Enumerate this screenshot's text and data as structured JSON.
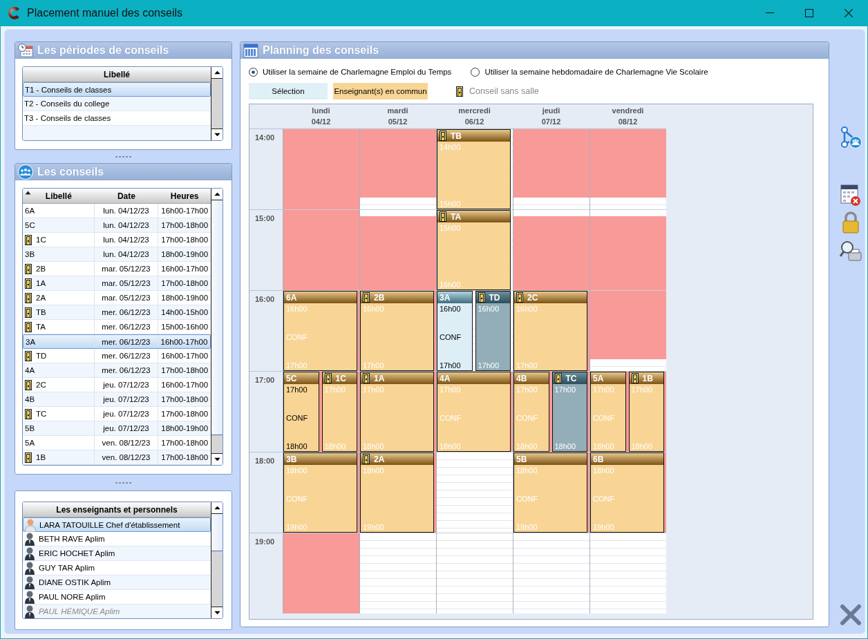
{
  "window": {
    "title": "Placement manuel des conseils"
  },
  "periods": {
    "title": "Les périodes de conseils",
    "column": "Libellé",
    "rows": [
      {
        "label": "T1 - Conseils de classes",
        "selected": true
      },
      {
        "label": "T2 - Conseils du college",
        "selected": false
      },
      {
        "label": "T3 - Conseils de classes",
        "selected": false
      }
    ]
  },
  "councils": {
    "title": "Les conseils",
    "columns": [
      "Libellé",
      "Date",
      "Heures"
    ],
    "rows": [
      {
        "label": "6A",
        "date": "lun. 04/12/23",
        "hours": "16h00-17h00",
        "no_room": false,
        "selected": false
      },
      {
        "label": "5C",
        "date": "lun. 04/12/23",
        "hours": "17h00-18h00",
        "no_room": false,
        "selected": false
      },
      {
        "label": "1C",
        "date": "lun. 04/12/23",
        "hours": "17h00-18h00",
        "no_room": true,
        "selected": false
      },
      {
        "label": "3B",
        "date": "lun. 04/12/23",
        "hours": "18h00-19h00",
        "no_room": false,
        "selected": false
      },
      {
        "label": "2B",
        "date": "mar. 05/12/23",
        "hours": "16h00-17h00",
        "no_room": true,
        "selected": false
      },
      {
        "label": "1A",
        "date": "mar. 05/12/23",
        "hours": "17h00-18h00",
        "no_room": true,
        "selected": false
      },
      {
        "label": "2A",
        "date": "mar. 05/12/23",
        "hours": "18h00-19h00",
        "no_room": true,
        "selected": false
      },
      {
        "label": "TB",
        "date": "mer. 06/12/23",
        "hours": "14h00-15h00",
        "no_room": true,
        "selected": false
      },
      {
        "label": "TA",
        "date": "mer. 06/12/23",
        "hours": "15h00-16h00",
        "no_room": true,
        "selected": false
      },
      {
        "label": "3A",
        "date": "mer. 06/12/23",
        "hours": "16h00-17h00",
        "no_room": false,
        "selected": true
      },
      {
        "label": "TD",
        "date": "mer. 06/12/23",
        "hours": "16h00-17h00",
        "no_room": true,
        "selected": false
      },
      {
        "label": "4A",
        "date": "mer. 06/12/23",
        "hours": "17h00-18h00",
        "no_room": false,
        "selected": false
      },
      {
        "label": "2C",
        "date": "jeu. 07/12/23",
        "hours": "16h00-17h00",
        "no_room": true,
        "selected": false
      },
      {
        "label": "4B",
        "date": "jeu. 07/12/23",
        "hours": "17h00-18h00",
        "no_room": false,
        "selected": false
      },
      {
        "label": "TC",
        "date": "jeu. 07/12/23",
        "hours": "17h00-18h00",
        "no_room": true,
        "selected": false
      },
      {
        "label": "5B",
        "date": "jeu. 07/12/23",
        "hours": "18h00-19h00",
        "no_room": false,
        "selected": false
      },
      {
        "label": "5A",
        "date": "ven. 08/12/23",
        "hours": "17h00-18h00",
        "no_room": false,
        "selected": false
      },
      {
        "label": "1B",
        "date": "ven. 08/12/23",
        "hours": "17h00-18h00",
        "no_room": true,
        "selected": false
      }
    ]
  },
  "staff": {
    "title": "Les enseignants et personnels",
    "rows": [
      {
        "name": "LARA TATOUILLE Chef d'établissement",
        "kind": "head",
        "selected": true,
        "disabled": false
      },
      {
        "name": "BETH RAVE Aplim",
        "kind": "teacher",
        "selected": false,
        "disabled": false
      },
      {
        "name": "ERIC HOCHET Aplim",
        "kind": "teacher",
        "selected": false,
        "disabled": false
      },
      {
        "name": "GUY TAR Aplim",
        "kind": "teacher",
        "selected": false,
        "disabled": false
      },
      {
        "name": "DIANE OSTIK Aplim",
        "kind": "teacher",
        "selected": false,
        "disabled": false
      },
      {
        "name": "PAUL NORE Aplim",
        "kind": "teacher",
        "selected": false,
        "disabled": false
      },
      {
        "name": "PAUL HÉMIQUE Aplim",
        "kind": "teacher",
        "selected": false,
        "disabled": true
      }
    ]
  },
  "planning": {
    "title": "Planning des conseils",
    "options": [
      {
        "label": "Utiliser la semaine de Charlemagne Emploi du Temps",
        "selected": true
      },
      {
        "label": "Utiliser la semaine hebdomadaire de Charlemagne Vie Scolaire",
        "selected": false
      }
    ],
    "legend": [
      {
        "label": "Sélection",
        "kind": "selection"
      },
      {
        "label": "Enseignant(s) en commun",
        "kind": "common"
      },
      {
        "label": "Conseil sans salle",
        "kind": "no_room"
      }
    ],
    "hours": [
      "14:00",
      "15:00",
      "16:00",
      "17:00",
      "18:00",
      "19:00"
    ],
    "days": [
      {
        "name": "lundi",
        "date": "04/12",
        "cells": [
          {
            "kind": "blocked"
          },
          {
            "kind": "blocked"
          },
          {
            "kind": "blocked",
            "events": [
              {
                "label": "6A",
                "start": "16h00",
                "note": "CONF",
                "end": "17h00",
                "kind": "common",
                "dark_text": false,
                "no_room": false
              }
            ]
          },
          {
            "kind": "blocked",
            "events": [
              {
                "label": "5C",
                "start": "17h00",
                "note": "CONF",
                "end": "18h00",
                "kind": "common",
                "dark_text": true,
                "no_room": false
              },
              {
                "label": "1C",
                "start": "17h00",
                "end": "18h00",
                "kind": "common",
                "dark_text": false,
                "no_room": true
              }
            ]
          },
          {
            "kind": "blocked",
            "events": [
              {
                "label": "3B",
                "start": "18h00",
                "note": "CONF",
                "end": "19h00",
                "kind": "common",
                "dark_text": false,
                "no_room": false
              }
            ]
          },
          {
            "kind": "blocked"
          }
        ]
      },
      {
        "name": "mardi",
        "date": "05/12",
        "cells": [
          {
            "kind": "blocked_top"
          },
          {
            "kind": "blocked_bottom"
          },
          {
            "kind": "blocked",
            "events": [
              {
                "label": "2B",
                "start": "16h00",
                "end": "17h00",
                "kind": "common",
                "dark_text": false,
                "no_room": true
              }
            ]
          },
          {
            "kind": "blocked",
            "events": [
              {
                "label": "1A",
                "start": "17h00",
                "end": "18h00",
                "kind": "common",
                "dark_text": false,
                "no_room": true
              }
            ]
          },
          {
            "kind": "blocked",
            "events": [
              {
                "label": "2A",
                "start": "18h00",
                "end": "19h00",
                "kind": "common",
                "dark_text": false,
                "no_room": true
              }
            ]
          },
          {
            "kind": "free"
          }
        ]
      },
      {
        "name": "mercredi",
        "date": "06/12",
        "cells": [
          {
            "kind": "free",
            "events": [
              {
                "label": "TB",
                "start": "14h00",
                "end": "15h00",
                "kind": "common",
                "dark_text": false,
                "no_room": true
              }
            ]
          },
          {
            "kind": "free",
            "events": [
              {
                "label": "TA",
                "start": "15h00",
                "end": "16h00",
                "kind": "common",
                "dark_text": false,
                "no_room": true
              }
            ]
          },
          {
            "kind": "free",
            "events": [
              {
                "label": "3A",
                "start": "16h00",
                "note": "CONF",
                "end": "17h00",
                "kind": "selection",
                "dark_text": true,
                "no_room": false
              },
              {
                "label": "TD",
                "start": "16h00",
                "end": "17h00",
                "kind": "other",
                "dark_text": false,
                "no_room": true
              }
            ]
          },
          {
            "kind": "blocked",
            "events": [
              {
                "label": "4A",
                "start": "17h00",
                "note": "CONF",
                "end": "18h00",
                "kind": "common",
                "dark_text": false,
                "no_room": false
              }
            ]
          },
          {
            "kind": "free"
          },
          {
            "kind": "free"
          }
        ]
      },
      {
        "name": "jeudi",
        "date": "07/12",
        "cells": [
          {
            "kind": "blocked_top"
          },
          {
            "kind": "blocked_bottom"
          },
          {
            "kind": "blocked",
            "events": [
              {
                "label": "2C",
                "start": "16h00",
                "end": "17h00",
                "kind": "common",
                "dark_text": false,
                "no_room": true
              }
            ]
          },
          {
            "kind": "blocked",
            "events": [
              {
                "label": "4B",
                "start": "17h00",
                "note": "CONF",
                "end": "18h00",
                "kind": "common",
                "dark_text": false,
                "no_room": false
              },
              {
                "label": "TC",
                "start": "17h00",
                "end": "18h00",
                "kind": "other",
                "dark_text": false,
                "no_room": true
              }
            ]
          },
          {
            "kind": "blocked",
            "events": [
              {
                "label": "5B",
                "start": "18h00",
                "note": "CONF",
                "end": "19h00",
                "kind": "common",
                "dark_text": false,
                "no_room": false
              }
            ]
          },
          {
            "kind": "free"
          }
        ]
      },
      {
        "name": "vendredi",
        "date": "08/12",
        "cells": [
          {
            "kind": "blocked_top"
          },
          {
            "kind": "blocked_bottom"
          },
          {
            "kind": "blocked_top"
          },
          {
            "kind": "blocked",
            "events": [
              {
                "label": "5A",
                "start": "17h00",
                "note": "CONF",
                "end": "18h00",
                "kind": "common",
                "dark_text": false,
                "no_room": false
              },
              {
                "label": "1B",
                "start": "17h00",
                "end": "18h00",
                "kind": "common",
                "dark_text": false,
                "no_room": true
              }
            ]
          },
          {
            "kind": "blocked",
            "events": [
              {
                "label": "6B",
                "start": "18h00",
                "note": "CONF",
                "end": "19h00",
                "kind": "common",
                "dark_text": false,
                "no_room": false
              }
            ]
          },
          {
            "kind": "free"
          }
        ]
      }
    ]
  }
}
